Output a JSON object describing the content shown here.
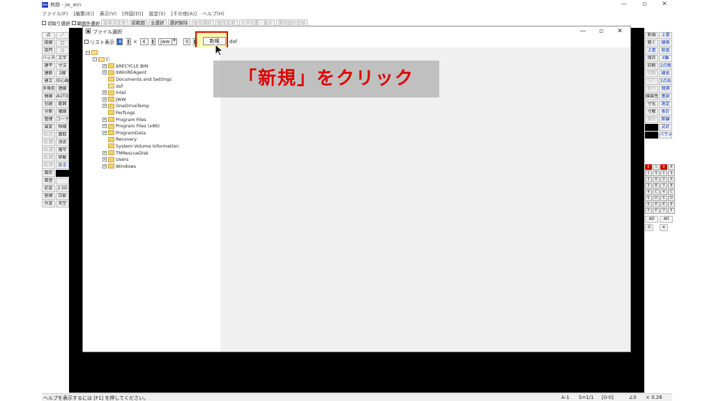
{
  "app": {
    "title": "無題 - jw_win",
    "icon_label": "Jww"
  },
  "window_controls": {
    "minimize": "—",
    "restore": "▫",
    "close": "✕"
  },
  "menu": [
    "ファイル(F)",
    "[編集(E)]",
    "表示(V)",
    "[作図(D)]",
    "設定(S)",
    "[その他(A)]",
    "ヘルプ(H)"
  ],
  "toolbar": {
    "cut_select": "切取り選択",
    "range_outside": "範囲外選択",
    "items": [
      {
        "label": "基準点変更",
        "disabled": true
      },
      {
        "label": "前範囲",
        "disabled": false
      },
      {
        "label": "全選択",
        "disabled": false
      },
      {
        "label": "選択解除",
        "disabled": false
      },
      {
        "label": "属性選択",
        "disabled": true
      },
      {
        "label": "属性変更",
        "disabled": true
      },
      {
        "label": "文字位置・集計",
        "disabled": true
      },
      {
        "label": "選択図形登録",
        "disabled": true
      }
    ]
  },
  "left_tools": [
    [
      "点",
      "／"
    ],
    [
      "接線",
      "□"
    ],
    [
      "接円",
      "○"
    ],
    [
      "ハッチ",
      "文字"
    ],
    [
      "建平",
      "寸法"
    ],
    [
      "建断",
      "2線"
    ],
    [
      "建立",
      "中心線"
    ],
    [
      "多角形",
      "連線"
    ],
    [
      "曲線",
      "AUTO"
    ],
    [
      "包絡",
      "範囲"
    ],
    [
      "分割",
      "複線"
    ],
    [
      "整理",
      "コーナー"
    ],
    [
      "属変",
      "伸縮"
    ],
    [
      "BL化",
      "面取"
    ],
    [
      "BL解",
      "消去"
    ],
    [
      "BL属",
      "複写"
    ],
    [
      "BL編",
      "移動"
    ],
    [
      "BL終",
      "戻る"
    ],
    [
      "図形",
      ""
    ],
    [
      "図登",
      ""
    ],
    [
      "記変",
      "2.5D"
    ],
    [
      "座標",
      "日影"
    ],
    [
      "外変",
      "天空"
    ]
  ],
  "right_tools": [
    [
      "新規",
      "上書"
    ],
    [
      "開く",
      "線角"
    ],
    [
      "上書",
      "鉛直"
    ],
    [
      "保存",
      "X軸"
    ],
    [
      "印刷",
      "2点角"
    ],
    [
      "切取",
      "線長"
    ],
    [
      "コピー",
      "2点長"
    ],
    [
      "貼付",
      "間隔"
    ],
    [
      "線属性",
      "基設"
    ],
    [
      "寸化",
      "測定"
    ],
    [
      "寸解",
      "表計"
    ],
    [
      "図形",
      "距離"
    ],
    [
      "",
      "式計"
    ],
    [
      "",
      "パラメ"
    ]
  ],
  "layers": [
    [
      "0",
      "1",
      "0",
      "8"
    ],
    [
      "1",
      "9",
      "1",
      "9"
    ],
    [
      "2",
      "A",
      "2",
      "A"
    ],
    [
      "3",
      "B",
      "3",
      "B"
    ],
    [
      "4",
      "C",
      "4",
      "C"
    ],
    [
      "5",
      "D",
      "5",
      "D"
    ],
    [
      "6",
      "E",
      "6",
      "E"
    ],
    [
      "7",
      "F",
      "7",
      "F"
    ]
  ],
  "layer_footer": [
    "All",
    "All",
    "0",
    "✕"
  ],
  "status": {
    "help": "ヘルプを表示するには [F1] を押してください。",
    "paper": "A-1",
    "scale": "S=1/1",
    "layer": "[0-0]",
    "angle": "∠0",
    "zoom": "× 0.26"
  },
  "dialog": {
    "title": "ファイル選択",
    "list_view": "リスト表示",
    "cols": "8",
    "times": "×",
    "rows": "4",
    "ext": "jww",
    "sort": "0",
    "new_button": "新規",
    "dxf": "dxf",
    "tree": [
      {
        "label": "",
        "level": 0,
        "expander": "⊟",
        "type": "root"
      },
      {
        "label": "C:",
        "level": 1,
        "expander": "⊟",
        "type": "drive"
      },
      {
        "label": "$RECYCLE.BIN",
        "level": 2,
        "expander": "⊞",
        "type": "folder"
      },
      {
        "label": "$WinREAgent",
        "level": 2,
        "expander": "⊞",
        "type": "folder"
      },
      {
        "label": "Documents and Settings",
        "level": 2,
        "expander": "",
        "type": "folder"
      },
      {
        "label": "dxf",
        "level": 2,
        "expander": "",
        "type": "open"
      },
      {
        "label": "Intel",
        "level": 2,
        "expander": "⊞",
        "type": "folder"
      },
      {
        "label": "JWW",
        "level": 2,
        "expander": "⊞",
        "type": "folder"
      },
      {
        "label": "OneDriveTemp",
        "level": 2,
        "expander": "⊞",
        "type": "folder"
      },
      {
        "label": "PerfLogs",
        "level": 2,
        "expander": "",
        "type": "folder"
      },
      {
        "label": "Program Files",
        "level": 2,
        "expander": "⊞",
        "type": "folder"
      },
      {
        "label": "Program Files (x86)",
        "level": 2,
        "expander": "⊞",
        "type": "folder"
      },
      {
        "label": "ProgramData",
        "level": 2,
        "expander": "⊞",
        "type": "folder"
      },
      {
        "label": "Recovery",
        "level": 2,
        "expander": "",
        "type": "folder"
      },
      {
        "label": "System Volume Information",
        "level": 2,
        "expander": "",
        "type": "folder"
      },
      {
        "label": "TMRescueDisk",
        "level": 2,
        "expander": "⊞",
        "type": "folder"
      },
      {
        "label": "Users",
        "level": 2,
        "expander": "⊞",
        "type": "folder"
      },
      {
        "label": "Windows",
        "level": 2,
        "expander": "⊞",
        "type": "folder"
      }
    ]
  },
  "annotation": "「新規」をクリック",
  "colors": {
    "annotation_text": "#e00000",
    "highlight_border": "#e00000",
    "highlight_fill": "#ffff6e",
    "canvas": "#000000"
  }
}
